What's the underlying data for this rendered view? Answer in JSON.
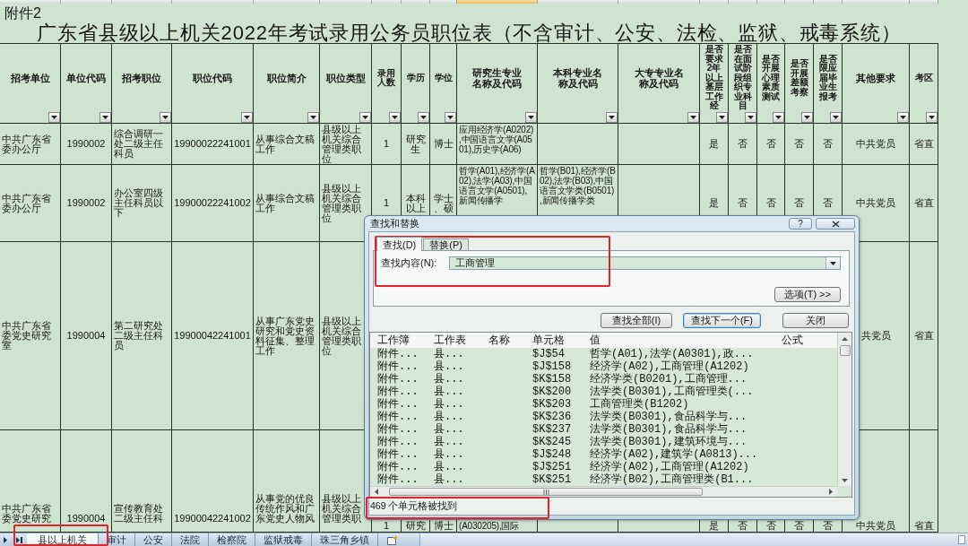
{
  "sheet": {
    "attachment_label": "附件2",
    "title": "广东省县级以上机关2022年考试录用公务员职位表（不含审计、公安、法检、监狱、戒毒系统）",
    "columns": [
      {
        "label": "招考单位",
        "selected": false
      },
      {
        "label": "单位代码",
        "selected": false
      },
      {
        "label": "招考职位",
        "selected": false
      },
      {
        "label": "职位代码",
        "selected": false
      },
      {
        "label": "职位简介",
        "selected": false
      },
      {
        "label": "职位类型",
        "selected": false
      },
      {
        "label": "录用人数",
        "selected": false
      },
      {
        "label": "学历",
        "selected": false
      },
      {
        "label": "学位",
        "selected": false
      },
      {
        "label": "研究生专业名称及代码",
        "selected": true
      },
      {
        "label": "本科专业名称及代码",
        "selected": false
      },
      {
        "label": "大专专业名称及代码",
        "selected": false
      },
      {
        "label": "是否要求2年以上基层工作经",
        "selected": false
      },
      {
        "label": "是否在面试阶段组织专业科目",
        "selected": false
      },
      {
        "label": "是否开展心理素质测试",
        "selected": false
      },
      {
        "label": "是否开展差额考察",
        "selected": false
      },
      {
        "label": "是否限应届毕业生报考",
        "selected": false
      },
      {
        "label": "其他要求",
        "selected": false
      },
      {
        "label": "考区",
        "selected": false
      }
    ],
    "rows": [
      {
        "unit": "中共广东省委办公厅",
        "unit_code": "1990002",
        "position": "综合调研一处二级主任科员",
        "position_code": "19900022241001",
        "description": "从事综合文稿工作",
        "position_type": "县级以上机关综合管理类职位",
        "hires": "1",
        "education": "研究生",
        "degree": "博士",
        "graduate_majors": "应用经济学(A0202),中国语言文学(A0501),历史学(A06)",
        "grassroots_experience": "是",
        "interview_subject_test": "否",
        "psychological_test": "否",
        "differential_review": "否",
        "fresh_graduates_only": "否",
        "other_requirements": "中共党员",
        "exam_area": "省直"
      },
      {
        "unit": "中共广东省委办公厅",
        "unit_code": "1990002",
        "position": "办公室四级主任科员以下",
        "position_code": "19900022241002",
        "description": "从事综合文稿工作",
        "position_type": "县级以上机关综合管理类职位",
        "hires": "1",
        "education": "本科以上",
        "degree": "学士、硕",
        "graduate_majors": "哲学(A01),经济学(A02),法学(A03),中国语言文学(A0501),新闻传播学",
        "undergraduate_majors": "哲学(B01),经济学(B02),法学(B03),中国语言文学类(B0501),新闻传播学类",
        "grassroots_experience": "是",
        "interview_subject_test": "否",
        "psychological_test": "否",
        "differential_review": "否",
        "fresh_graduates_only": "否",
        "other_requirements": "中共党员",
        "exam_area": "省直"
      },
      {
        "unit": "中共广东省委党史研究室",
        "unit_code": "1990004",
        "position": "第二研究处二级主任科员",
        "position_code": "19900042241001",
        "description": "从事广东党史研究和党史资料征集、整理工作",
        "position_type": "县级以上机关综合管理类职位",
        "other_requirements": "共党员",
        "exam_area": "省直"
      },
      {
        "unit": "中共广东省委党史研究",
        "unit_code": "1990004",
        "position": "宣传教育处二级主任科",
        "position_code": "19900042241002",
        "description": "从事党的优良传统作风和广东党史人物风",
        "position_type": "县级以上机关综合管理类职",
        "hires": "1",
        "education": "研究",
        "degree": "博士",
        "graduate_majors": "(A030205),国际",
        "grassroots_experience": "是",
        "interview_subject_test": "否",
        "psychological_test": "否",
        "differential_review": "否",
        "fresh_graduates_only": "否",
        "other_requirements": "中共党员",
        "exam_area": "省直"
      }
    ]
  },
  "find_dialog": {
    "title": "查找和替换",
    "help_button": "?",
    "tabs": [
      {
        "label": "查找(D)",
        "selected": true
      },
      {
        "label": "替换(P)",
        "selected": false
      }
    ],
    "find_label": "查找内容(N):",
    "find_value": "工商管理",
    "options_button": "选项(T) >>",
    "buttons": [
      {
        "label": "查找全部(I)",
        "focused": false
      },
      {
        "label": "查找下一个(F)",
        "focused": true
      },
      {
        "label": "关闭",
        "focused": false
      }
    ],
    "result_columns": [
      "工作簿",
      "工作表",
      "名称",
      "单元格",
      "值",
      "公式"
    ],
    "results": [
      {
        "workbook": "附件...",
        "sheet": "县...",
        "cell": "$J$54",
        "value": "哲学(A01),法学(A0301),政..."
      },
      {
        "workbook": "附件...",
        "sheet": "县...",
        "cell": "$J$158",
        "value": "经济学(A02),工商管理(A1202)"
      },
      {
        "workbook": "附件...",
        "sheet": "县...",
        "cell": "$K$158",
        "value": "经济学类(B0201),工商管理..."
      },
      {
        "workbook": "附件...",
        "sheet": "县...",
        "cell": "$K$200",
        "value": "法学类(B0301),工商管理类(..."
      },
      {
        "workbook": "附件...",
        "sheet": "县...",
        "cell": "$K$203",
        "value": "工商管理类(B1202)"
      },
      {
        "workbook": "附件...",
        "sheet": "县...",
        "cell": "$K$236",
        "value": "法学类(B0301),食品科学与..."
      },
      {
        "workbook": "附件...",
        "sheet": "县...",
        "cell": "$K$237",
        "value": "法学类(B0301),食品科学与..."
      },
      {
        "workbook": "附件...",
        "sheet": "县...",
        "cell": "$K$245",
        "value": "法学类(B0301),建筑环境与..."
      },
      {
        "workbook": "附件...",
        "sheet": "县...",
        "cell": "$J$248",
        "value": "经济学(A02),建筑学(A0813)..."
      },
      {
        "workbook": "附件...",
        "sheet": "县...",
        "cell": "$J$251",
        "value": "经济学(A02),工商管理(A1202)"
      },
      {
        "workbook": "附件...",
        "sheet": "县...",
        "cell": "$K$251",
        "value": "经济学(B02),工商管理类(B1..."
      }
    ],
    "status": "469 个单元格被找到"
  },
  "sheet_tabs": [
    {
      "label": "县以上机关",
      "selected": true
    },
    {
      "label": "审计",
      "selected": false
    },
    {
      "label": "公安",
      "selected": false
    },
    {
      "label": "法院",
      "selected": false
    },
    {
      "label": "检察院",
      "selected": false
    },
    {
      "label": "监狱戒毒",
      "selected": false
    },
    {
      "label": "珠三角乡镇",
      "selected": false
    }
  ]
}
